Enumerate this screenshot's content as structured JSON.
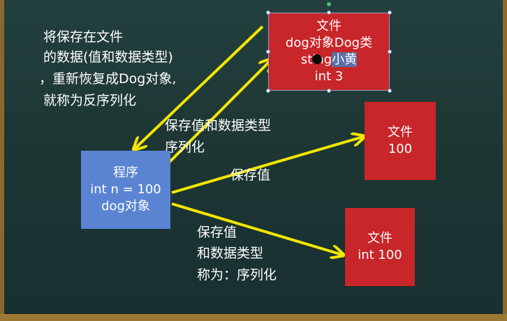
{
  "colors": {
    "board": "#1d3534",
    "arrow": "#f2e600",
    "red_box": "#c8262a",
    "blue_box": "#5a84d2"
  },
  "deserialize_note": [
    "将保存在文件",
    "的数据(值和数据类型)",
    "，重新恢复成Dog对象,",
    "就称为反序列化"
  ],
  "serialize_type_label": [
    "保存值和数据类型",
    "序列化"
  ],
  "save_value_label": "保存值",
  "serialize_note": [
    "保存值",
    "和数据类型",
    "称为：序列化"
  ],
  "program_box": {
    "line1": "程序",
    "line2": "int n = 100",
    "line3": "dog对象"
  },
  "file_box_dog": {
    "line1": "文件",
    "line2": "dog对象Dog类",
    "line3_prefix": "sting",
    "line3_highlight": "小黄",
    "line4": "int 3"
  },
  "file_box_value": {
    "line1": "文件",
    "line2": "100"
  },
  "file_box_typed": {
    "line1": "文件",
    "line2": "int 100"
  }
}
